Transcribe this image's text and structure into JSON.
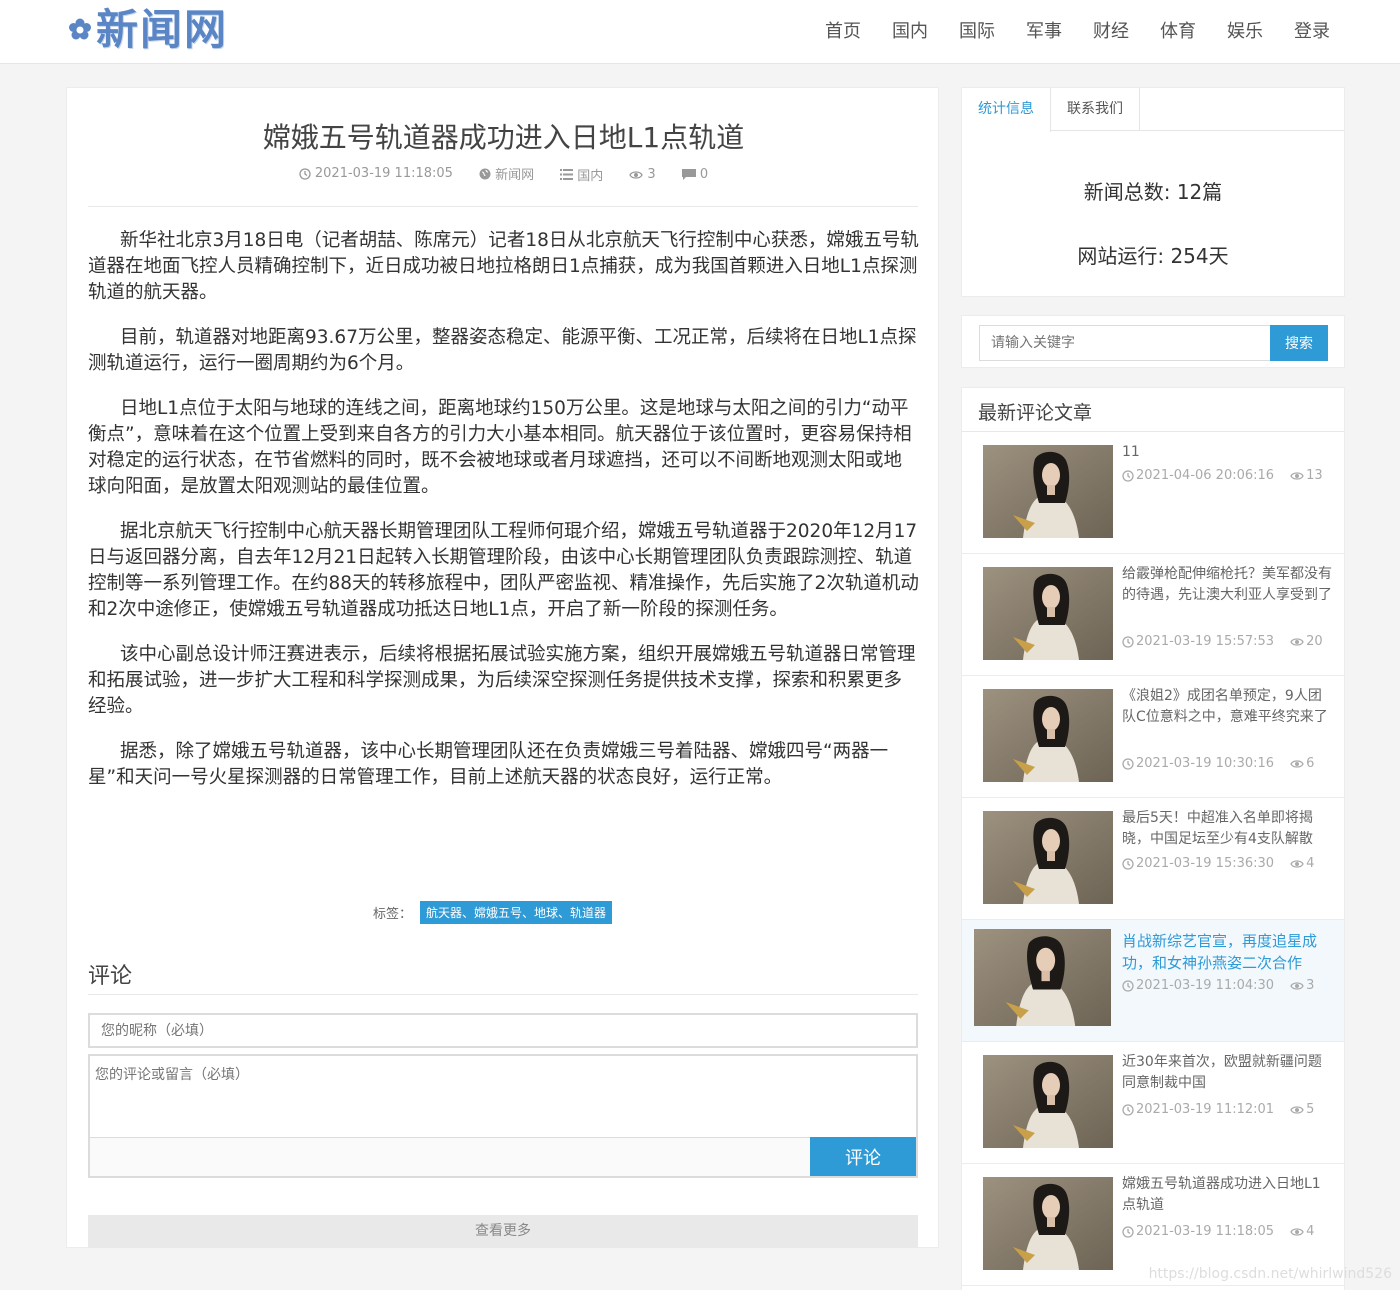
{
  "header": {
    "logo_text": "新闻网",
    "nav": [
      "首页",
      "国内",
      "国际",
      "军事",
      "财经",
      "体育",
      "娱乐",
      "登录"
    ]
  },
  "article": {
    "title": "嫦娥五号轨道器成功进入日地L1点轨道",
    "datetime": "2021-03-19 11:18:05",
    "source": "新闻网",
    "category": "国内",
    "views": "3",
    "comments": "0",
    "paragraphs": [
      "新华社北京3月18日电（记者胡喆、陈席元）记者18日从北京航天飞行控制中心获悉，嫦娥五号轨道器在地面飞控人员精确控制下，近日成功被日地拉格朗日1点捕获，成为我国首颗进入日地L1点探测轨道的航天器。",
      "目前，轨道器对地距离93.67万公里，整器姿态稳定、能源平衡、工况正常，后续将在日地L1点探测轨道运行，运行一圈周期约为6个月。",
      "日地L1点位于太阳与地球的连线之间，距离地球约150万公里。这是地球与太阳之间的引力“动平衡点”，意味着在这个位置上受到来自各方的引力大小基本相同。航天器位于该位置时，更容易保持相对稳定的运行状态，在节省燃料的同时，既不会被地球或者月球遮挡，还可以不间断地观测太阳或地球向阳面，是放置太阳观测站的最佳位置。",
      "据北京航天飞行控制中心航天器长期管理团队工程师何琨介绍，嫦娥五号轨道器于2020年12月17日与返回器分离，自去年12月21日起转入长期管理阶段，由该中心长期管理团队负责跟踪测控、轨道控制等一系列管理工作。在约88天的转移旅程中，团队严密监视、精准操作，先后实施了2次轨道机动和2次中途修正，使嫦娥五号轨道器成功抵达日地L1点，开启了新一阶段的探测任务。",
      "该中心副总设计师汪赛进表示，后续将根据拓展试验实施方案，组织开展嫦娥五号轨道器日常管理和拓展试验，进一步扩大工程和科学探测成果，为后续深空探测任务提供技术支撑，探索和积累更多经验。",
      "据悉，除了嫦娥五号轨道器，该中心长期管理团队还在负责嫦娥三号着陆器、嫦娥四号“两器一星”和天问一号火星探测器的日常管理工作，目前上述航天器的状态良好，运行正常。"
    ],
    "tags_label": "标签：",
    "tags": "航天器、嫦娥五号、地球、轨道器"
  },
  "comment": {
    "title": "评论",
    "nick_placeholder": "您的昵称（必填）",
    "text_placeholder": "您的评论或留言（必填）",
    "submit": "评论",
    "more": "查看更多"
  },
  "sidebar": {
    "tabs": [
      "统计信息",
      "联系我们"
    ],
    "stats": [
      "新闻总数: 12篇",
      "网站运行: 254天"
    ],
    "search_placeholder": "请输入关键字",
    "search_button": "搜索",
    "latest_title": "最新评论文章",
    "posts": [
      {
        "title": "11",
        "time": "2021-04-06 20:06:16",
        "views": "13"
      },
      {
        "title": "给霰弹枪配伸缩枪托？美军都没有的待遇，先让澳大利亚人享受到了",
        "time": "2021-03-19 15:57:53",
        "views": "20"
      },
      {
        "title": "《浪姐2》成团名单预定，9人团队C位意料之中，意难平终究来了",
        "time": "2021-03-19 10:30:16",
        "views": "6"
      },
      {
        "title": "最后5天！中超准入名单即将揭晓，中国足坛至少有4支队解散",
        "time": "2021-03-19 15:36:30",
        "views": "4"
      },
      {
        "title": "肖战新综艺官宣，再度追星成功，和女神孙燕姿二次合作",
        "time": "2021-03-19 11:04:30",
        "views": "3"
      },
      {
        "title": "近30年来首次，欧盟就新疆问题同意制裁中国",
        "time": "2021-03-19 11:12:01",
        "views": "5"
      },
      {
        "title": "嫦娥五号轨道器成功进入日地L1点轨道",
        "time": "2021-03-19 11:18:05",
        "views": "4"
      }
    ]
  },
  "watermark": "https://blog.csdn.net/whirlwind526"
}
